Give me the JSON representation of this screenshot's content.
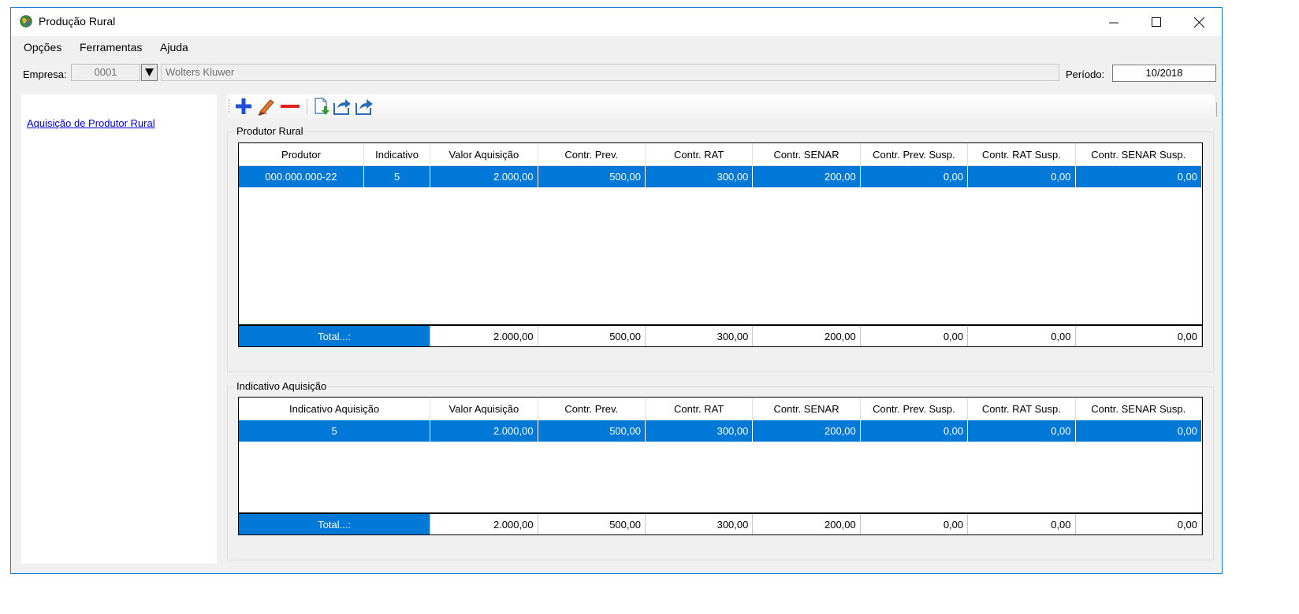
{
  "window": {
    "title": "Produção Rural",
    "controls": {
      "minimize": "—",
      "maximize": "☐",
      "close": "✕"
    }
  },
  "menu": [
    "Opções",
    "Ferramentas",
    "Ajuda"
  ],
  "empresa": {
    "label": "Empresa:",
    "code": "0001",
    "name": "Wolters Kluwer"
  },
  "periodo": {
    "label": "Período:",
    "value": "10/2018"
  },
  "sidebar": {
    "link": "Aquisição de Produtor Rural"
  },
  "toolbar": [
    "add-icon",
    "edit-icon",
    "remove-icon",
    "import-icon",
    "undo-icon",
    "export-icon"
  ],
  "colors": {
    "accent": "#0078d7",
    "add": "#1f4fd8",
    "remove": "#e02020"
  },
  "produtor": {
    "title": "Produtor Rural",
    "columns": [
      "Produtor",
      "Indicativo",
      "Valor Aquisição",
      "Contr. Prev.",
      "Contr. RAT",
      "Contr. SENAR",
      "Contr. Prev. Susp.",
      "Contr. RAT Susp.",
      "Contr. SENAR Susp."
    ],
    "rows": [
      [
        "000.000.000-22",
        "5",
        "2.000,00",
        "500,00",
        "300,00",
        "200,00",
        "0,00",
        "0,00",
        "0,00"
      ]
    ],
    "total_label": "Total...:",
    "totals": [
      "2.000,00",
      "500,00",
      "300,00",
      "200,00",
      "0,00",
      "0,00",
      "0,00"
    ]
  },
  "indicativo": {
    "title": "Indicativo Aquisição",
    "columns": [
      "Indicativo Aquisição",
      "Valor Aquisição",
      "Contr. Prev.",
      "Contr. RAT",
      "Contr. SENAR",
      "Contr. Prev. Susp.",
      "Contr. RAT Susp.",
      "Contr. SENAR Susp."
    ],
    "rows": [
      [
        "5",
        "2.000,00",
        "500,00",
        "300,00",
        "200,00",
        "0,00",
        "0,00",
        "0,00"
      ]
    ],
    "total_label": "Total...:",
    "totals": [
      "2.000,00",
      "500,00",
      "300,00",
      "200,00",
      "0,00",
      "0,00",
      "0,00"
    ]
  }
}
